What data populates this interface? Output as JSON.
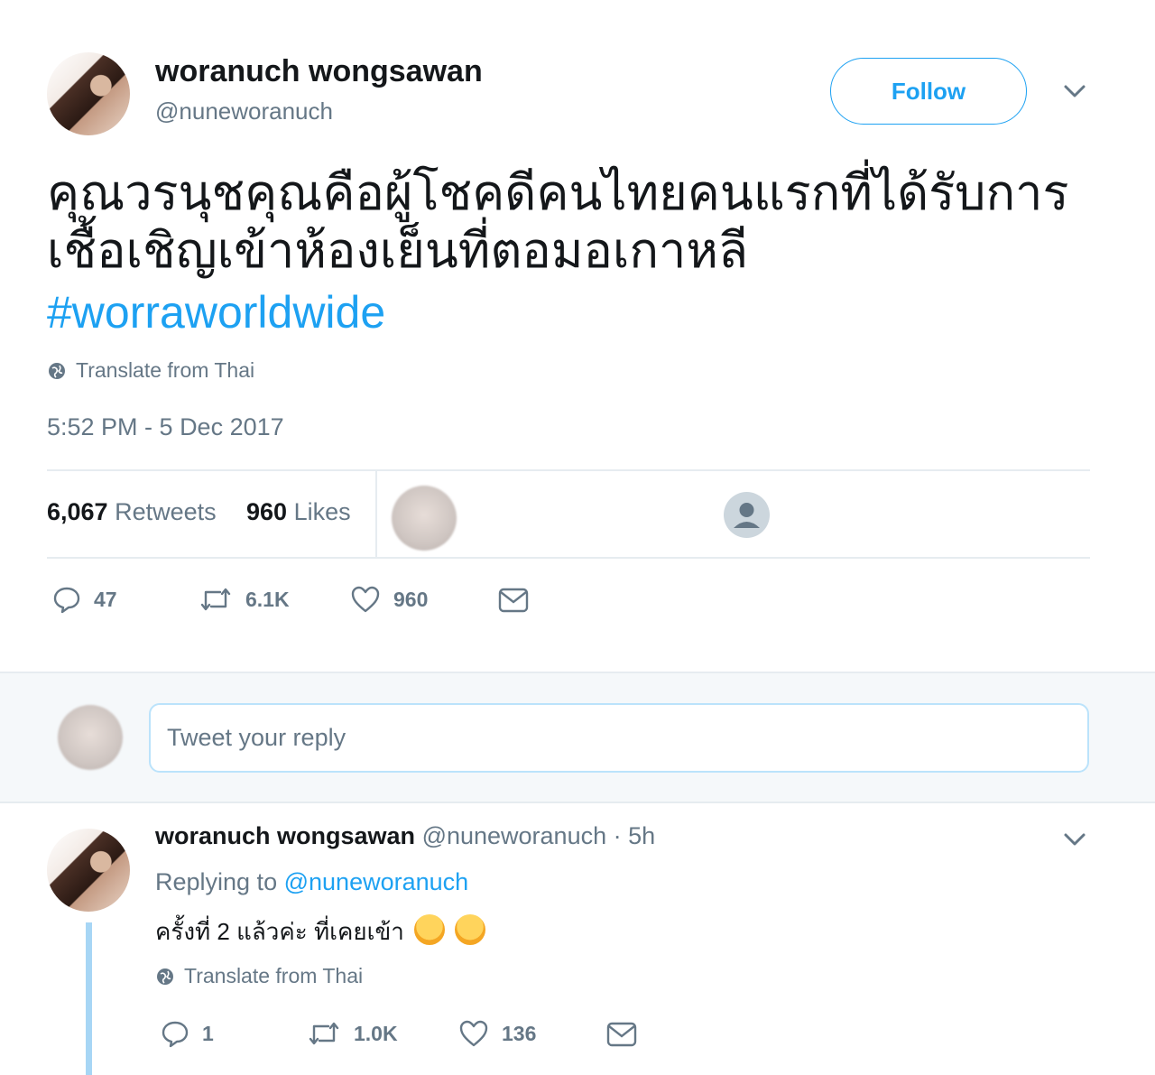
{
  "tweet": {
    "display_name": "woranuch wongsawan",
    "handle": "@nuneworanuch",
    "follow_label": "Follow",
    "text_line1": "คุณวรนุชคุณคือผู้โชคดีคนไทยคนแรกที่ได้รับการ",
    "text_line2": "เชื้อเชิญเข้าห้องเย็นที่ตอมอเกาหลี",
    "hashtag": "#worraworldwide",
    "translate_label": "Translate from Thai",
    "timestamp": "5:52 PM - 5 Dec 2017",
    "retweets_count": "6,067",
    "retweets_label": "Retweets",
    "likes_count": "960",
    "likes_label": "Likes",
    "actions": {
      "replies": "47",
      "retweets": "6.1K",
      "likes": "960"
    }
  },
  "reply_box": {
    "placeholder": "Tweet your reply"
  },
  "reply": {
    "display_name": "woranuch wongsawan",
    "handle": "@nuneworanuch",
    "time": "· 5h",
    "replying_prefix": "Replying to",
    "replying_handle": "@nuneworanuch",
    "text": "ครั้งที่ 2 แล้วค่ะ ที่เคยเข้า",
    "translate_label": "Translate from Thai",
    "actions": {
      "replies": "1",
      "retweets": "1.0K",
      "likes": "136"
    }
  },
  "colors": {
    "accent": "#1da1f2",
    "muted": "#657786",
    "divider": "#e6ecf0"
  }
}
